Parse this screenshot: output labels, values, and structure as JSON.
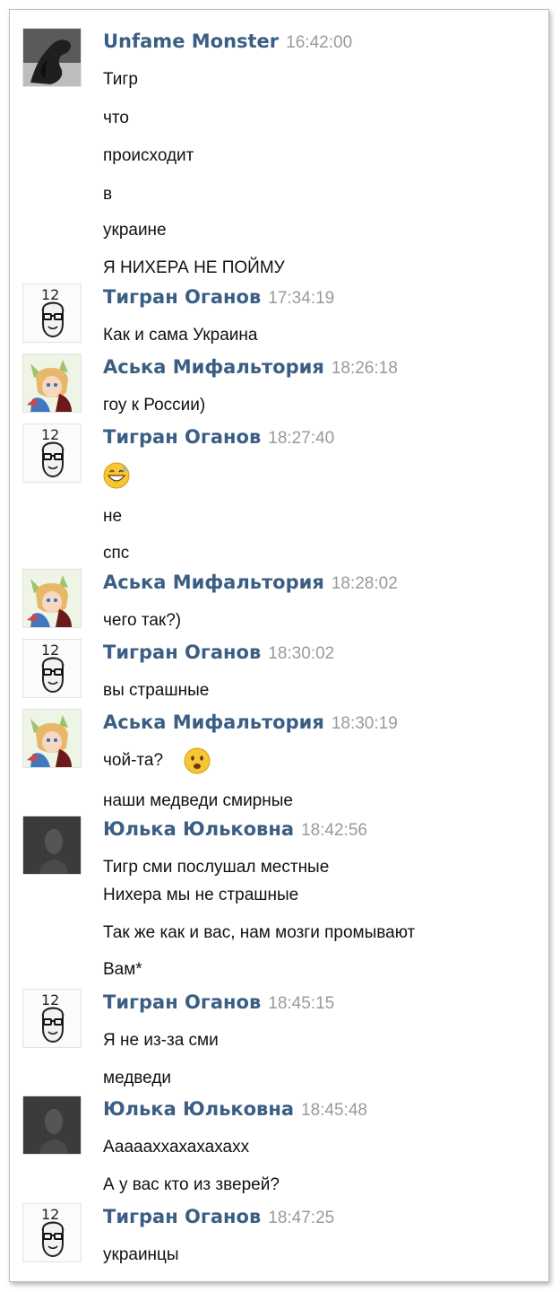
{
  "messages": [
    {
      "author": "Unfame Monster",
      "time": "16:42:00",
      "avatar": "monster-avatar",
      "lines": [
        "Тигр",
        "что",
        "происходит",
        "в",
        "украине",
        "Я НИХЕРА НЕ ПОЙМУ"
      ]
    },
    {
      "author": "Тигран Оганов",
      "time": "17:34:19",
      "avatar": "man-glasses-avatar",
      "lines": [
        "Как и сама Украина"
      ]
    },
    {
      "author": "Аська Мифальтория",
      "time": "18:26:18",
      "avatar": "anime-avatar",
      "lines": [
        "гоу к России)"
      ]
    },
    {
      "author": "Тигран Оганов",
      "time": "18:27:40",
      "avatar": "man-glasses-avatar",
      "lines": [
        "не",
        "спс"
      ],
      "emoji": "grinning-sweat-emoji"
    },
    {
      "author": "Аська Мифальтория",
      "time": "18:28:02",
      "avatar": "anime-avatar",
      "lines": [
        "чего так?)"
      ]
    },
    {
      "author": "Тигран Оганов",
      "time": "18:30:02",
      "avatar": "man-glasses-avatar",
      "lines": [
        "вы страшные"
      ]
    },
    {
      "author": "Аська Мифальтория",
      "time": "18:30:19",
      "avatar": "anime-avatar",
      "lines": [
        "чой-та?",
        "наши медведи смирные"
      ],
      "emoji": "frowning-emoji"
    },
    {
      "author": "Юлька Юльковна",
      "time": "18:42:56",
      "avatar": "dark-avatar",
      "lines": [
        "Тигр сми послушал местные",
        "Нихера мы не страшные",
        "Так же как и вас, нам мозги промывают",
        "Вам*"
      ]
    },
    {
      "author": "Тигран Оганов",
      "time": "18:45:15",
      "avatar": "man-glasses-avatar",
      "lines": [
        "Я не из-за сми",
        "медведи"
      ]
    },
    {
      "author": "Юлька Юльковна",
      "time": "18:45:48",
      "avatar": "dark-avatar",
      "lines": [
        "Аааааххахахахахх",
        "А у вас кто из зверей?"
      ]
    },
    {
      "author": "Тигран Оганов",
      "time": "18:47:25",
      "avatar": "man-glasses-avatar",
      "lines": [
        "украинцы"
      ]
    }
  ],
  "avatar_digits": "12",
  "colors": {
    "author": "#3b5e84",
    "time": "#9a9a9a",
    "text": "#111111"
  }
}
